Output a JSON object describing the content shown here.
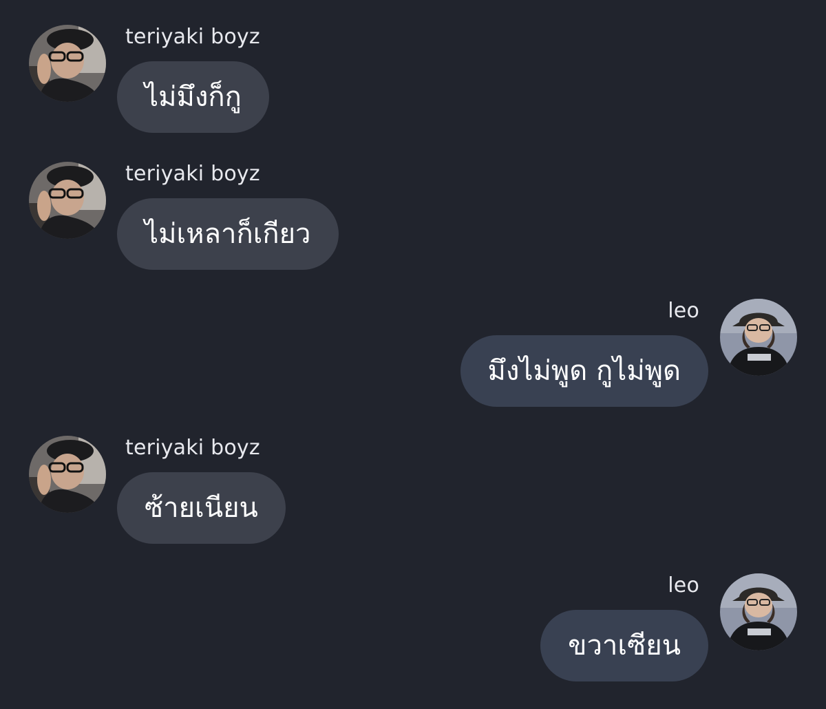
{
  "messages": [
    {
      "sender": "teriyaki boyz",
      "direction": "incoming",
      "text": "ไม่มึงก็กู",
      "avatar": "avatar-teriyaki-boyz"
    },
    {
      "sender": "teriyaki boyz",
      "direction": "incoming",
      "text": "ไม่เหลาก็เกียว",
      "avatar": "avatar-teriyaki-boyz"
    },
    {
      "sender": "leo",
      "direction": "outgoing",
      "text": "มึงไม่พูด กูไม่พูด",
      "avatar": "avatar-leo"
    },
    {
      "sender": "teriyaki boyz",
      "direction": "incoming",
      "text": "ซ้ายเนียน",
      "avatar": "avatar-teriyaki-boyz"
    },
    {
      "sender": "leo",
      "direction": "outgoing",
      "text": "ขวาเซียน",
      "avatar": "avatar-leo"
    }
  ],
  "colors": {
    "background": "#21242d",
    "incoming_bubble": "#3d414c",
    "outgoing_bubble": "#394152",
    "text": "#ffffff"
  }
}
